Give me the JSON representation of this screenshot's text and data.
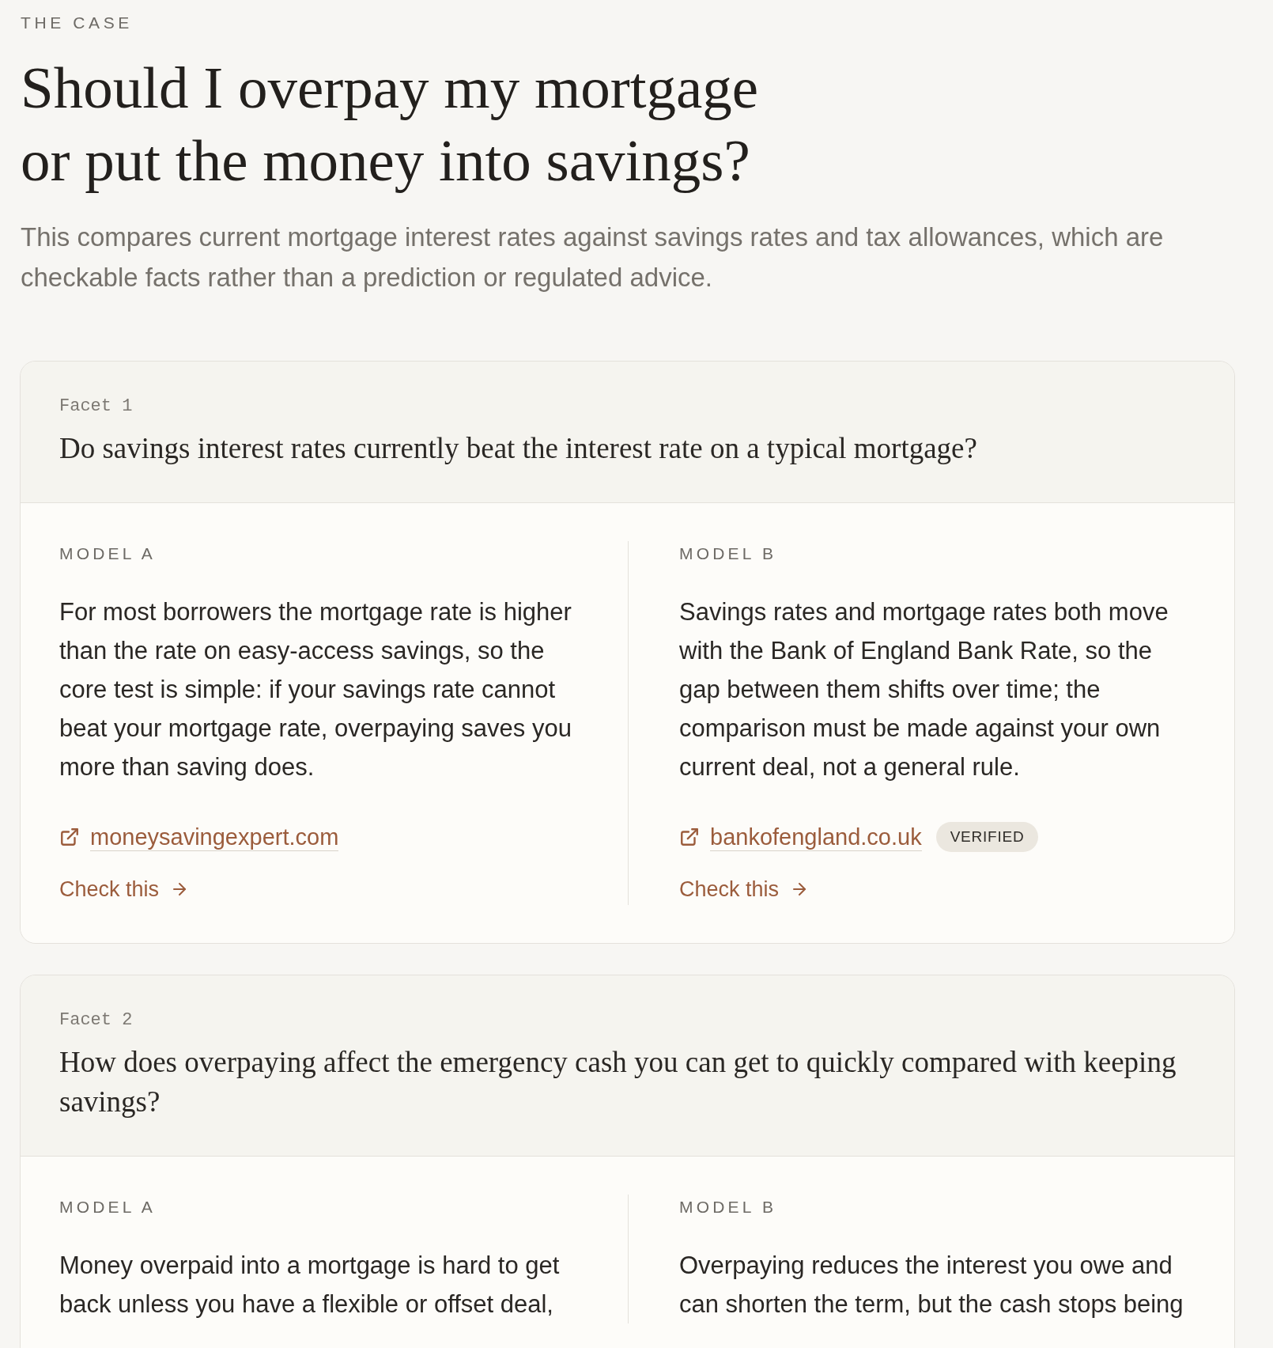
{
  "header": {
    "eyebrow": "THE CASE",
    "title": "Should I overpay my mortgage or put the money into savings?",
    "intro": "This compares current mortgage interest rates against savings rates and tax allowances, which are checkable facts rather than a prediction or regulated advice."
  },
  "facets": [
    {
      "label": "Facet 1",
      "question": "Do savings interest rates currently beat the interest rate on a typical mortgage?",
      "answers": [
        {
          "model": "MODEL A",
          "text": "For most borrowers the mortgage rate is higher than the rate on easy-access savings, so the core test is simple: if your savings rate cannot beat your mortgage rate, overpaying saves you more than saving does.",
          "source": {
            "domain": "moneysavingexpert.com"
          },
          "action": "Check this"
        },
        {
          "model": "MODEL B",
          "text": "Savings rates and mortgage rates both move with the Bank of England Bank Rate, so the gap between them shifts over time; the comparison must be made against your own current deal, not a general rule.",
          "source": {
            "domain": "bankofengland.co.uk",
            "badge": "VERIFIED"
          },
          "action": "Check this"
        }
      ]
    },
    {
      "label": "Facet 2",
      "question": "How does overpaying affect the emergency cash you can get to quickly compared with keeping savings?",
      "answers": [
        {
          "model": "MODEL A",
          "text": "Money overpaid into a mortgage is hard to get back unless you have a flexible or offset deal,"
        },
        {
          "model": "MODEL B",
          "text": "Overpaying reduces the interest you owe and can shorten the term, but the cash stops being"
        }
      ]
    }
  ]
}
